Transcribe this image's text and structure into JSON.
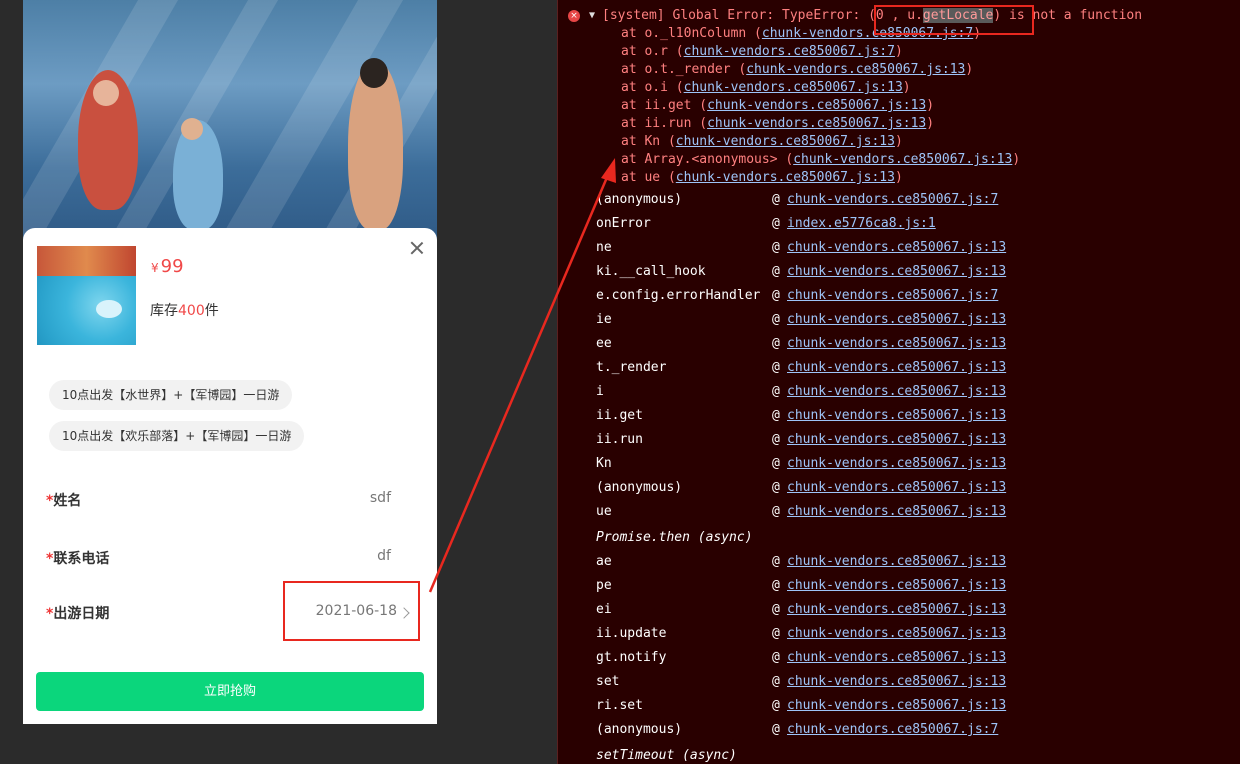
{
  "mobile": {
    "price_symbol": "¥",
    "price": "99",
    "stock_prefix": "库存",
    "stock_count": "400",
    "stock_suffix": "件",
    "tags": [
      "10点出发【水世界】+【军博园】一日游",
      "10点出发【欢乐部落】+【军博园】一日游"
    ],
    "fields": [
      {
        "required": "*",
        "label": "姓名",
        "value": "sdf"
      },
      {
        "required": "*",
        "label": "联系电话",
        "value": "df"
      },
      {
        "required": "*",
        "label": "出游日期",
        "value": "2021-06-18"
      }
    ],
    "buy_button": "立即抢购"
  },
  "console": {
    "error_icon": "×",
    "expand_icon": "▼",
    "error_prefix": "[system] Global Error: TypeError: ",
    "error_highlight_open": "(0 , u.",
    "error_highlight_word": "getLocale",
    "error_highlight_close": ")",
    "error_suffix": " is not a function",
    "stack": [
      {
        "text": "at o._l10nColumn (",
        "link": "chunk-vendors.ce850067.js:7",
        "close": ")"
      },
      {
        "text": "at o.r (",
        "link": "chunk-vendors.ce850067.js:7",
        "close": ")"
      },
      {
        "text": "at o.t._render (",
        "link": "chunk-vendors.ce850067.js:13",
        "close": ")"
      },
      {
        "text": "at o.i (",
        "link": "chunk-vendors.ce850067.js:13",
        "close": ")"
      },
      {
        "text": "at ii.get (",
        "link": "chunk-vendors.ce850067.js:13",
        "close": ")"
      },
      {
        "text": "at ii.run (",
        "link": "chunk-vendors.ce850067.js:13",
        "close": ")"
      },
      {
        "text": "at Kn (",
        "link": "chunk-vendors.ce850067.js:13",
        "close": ")"
      },
      {
        "text": "at Array.<anonymous> (",
        "link": "chunk-vendors.ce850067.js:13",
        "close": ")"
      },
      {
        "text": "at ue (",
        "link": "chunk-vendors.ce850067.js:13",
        "close": ")"
      }
    ],
    "at_symbol": "@",
    "frames": [
      {
        "fn": "(anonymous)",
        "src": "chunk-vendors.ce850067.js:7"
      },
      {
        "fn": "onError",
        "src": "index.e5776ca8.js:1"
      },
      {
        "fn": "ne",
        "src": "chunk-vendors.ce850067.js:13"
      },
      {
        "fn": "ki.__call_hook",
        "src": "chunk-vendors.ce850067.js:13"
      },
      {
        "fn": "e.config.errorHandler",
        "src": "chunk-vendors.ce850067.js:7"
      },
      {
        "fn": "ie",
        "src": "chunk-vendors.ce850067.js:13"
      },
      {
        "fn": "ee",
        "src": "chunk-vendors.ce850067.js:13"
      },
      {
        "fn": "t._render",
        "src": "chunk-vendors.ce850067.js:13"
      },
      {
        "fn": "i",
        "src": "chunk-vendors.ce850067.js:13"
      },
      {
        "fn": "ii.get",
        "src": "chunk-vendors.ce850067.js:13"
      },
      {
        "fn": "ii.run",
        "src": "chunk-vendors.ce850067.js:13"
      },
      {
        "fn": "Kn",
        "src": "chunk-vendors.ce850067.js:13"
      },
      {
        "fn": "(anonymous)",
        "src": "chunk-vendors.ce850067.js:13"
      },
      {
        "fn": "ue",
        "src": "chunk-vendors.ce850067.js:13"
      }
    ],
    "async1": "Promise.then (async)",
    "frames2": [
      {
        "fn": "ae",
        "src": "chunk-vendors.ce850067.js:13"
      },
      {
        "fn": "pe",
        "src": "chunk-vendors.ce850067.js:13"
      },
      {
        "fn": "ei",
        "src": "chunk-vendors.ce850067.js:13"
      },
      {
        "fn": "ii.update",
        "src": "chunk-vendors.ce850067.js:13"
      },
      {
        "fn": "gt.notify",
        "src": "chunk-vendors.ce850067.js:13"
      },
      {
        "fn": "set",
        "src": "chunk-vendors.ce850067.js:13"
      },
      {
        "fn": "ri.set",
        "src": "chunk-vendors.ce850067.js:13"
      },
      {
        "fn": "(anonymous)",
        "src": "chunk-vendors.ce850067.js:7"
      }
    ],
    "async2": "setTimeout (async)"
  },
  "colors": {
    "console_bg": "#290000",
    "error_text": "#ff8080",
    "link": "#9ec4f8",
    "buy_button": "#0bd67c",
    "price": "#f04848",
    "annotation": "#e8281f"
  }
}
